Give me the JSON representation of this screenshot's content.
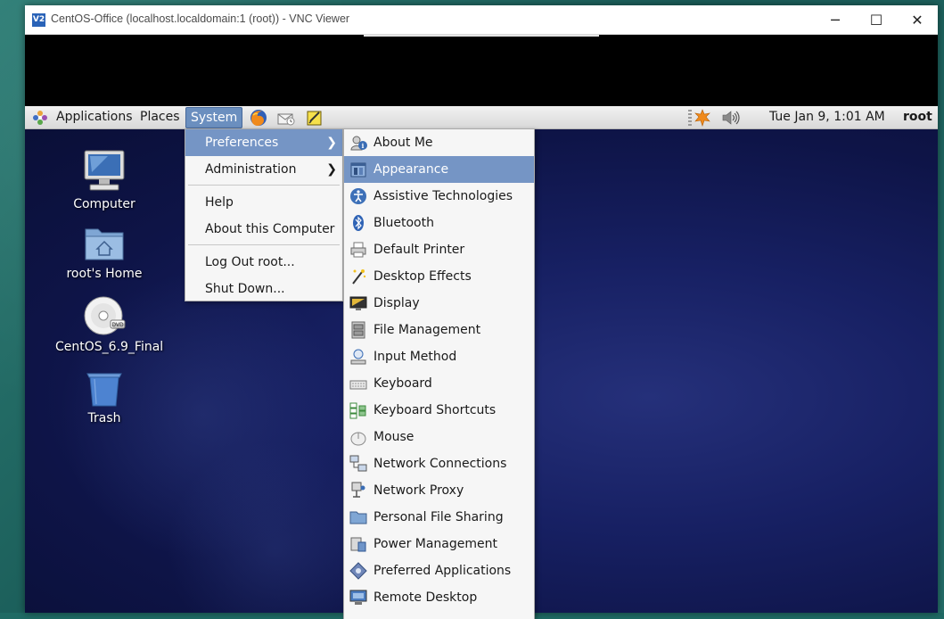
{
  "window": {
    "title": "CentOS-Office (localhost.localdomain:1 (root)) - VNC Viewer",
    "icon_text": "V2",
    "controls": {
      "minimize": "─",
      "maximize": "☐",
      "close": "✕"
    }
  },
  "panel": {
    "applications": "Applications",
    "places": "Places",
    "system": "System",
    "launchers": [
      "firefox-icon",
      "mail-icon",
      "notes-icon"
    ],
    "clock": "Tue Jan  9,  1:01 AM",
    "user": "root"
  },
  "desktop": {
    "icons": [
      {
        "label": "Computer",
        "icon": "computer-icon"
      },
      {
        "label": "root's Home",
        "icon": "home-folder-icon"
      },
      {
        "label": "CentOS_6.9_Final",
        "icon": "dvd-icon"
      },
      {
        "label": "Trash",
        "icon": "trash-icon"
      }
    ]
  },
  "system_menu": {
    "items": [
      {
        "label": "Preferences",
        "submenu": true,
        "highlighted": true
      },
      {
        "label": "Administration",
        "submenu": true
      },
      {
        "label": "Help"
      },
      {
        "label": "About this Computer"
      },
      {
        "label": "Log Out root..."
      },
      {
        "label": "Shut Down..."
      }
    ]
  },
  "preferences_menu": {
    "items": [
      {
        "label": "About Me",
        "icon": "about-me-icon"
      },
      {
        "label": "Appearance",
        "icon": "appearance-icon",
        "highlighted": true
      },
      {
        "label": "Assistive Technologies",
        "icon": "accessibility-icon"
      },
      {
        "label": "Bluetooth",
        "icon": "bluetooth-icon"
      },
      {
        "label": "Default Printer",
        "icon": "printer-icon"
      },
      {
        "label": "Desktop Effects",
        "icon": "desktop-effects-icon"
      },
      {
        "label": "Display",
        "icon": "display-icon"
      },
      {
        "label": "File Management",
        "icon": "file-management-icon"
      },
      {
        "label": "Input Method",
        "icon": "input-method-icon"
      },
      {
        "label": "Keyboard",
        "icon": "keyboard-icon"
      },
      {
        "label": "Keyboard Shortcuts",
        "icon": "keyboard-shortcuts-icon"
      },
      {
        "label": "Mouse",
        "icon": "mouse-icon"
      },
      {
        "label": "Network Connections",
        "icon": "network-connections-icon"
      },
      {
        "label": "Network Proxy",
        "icon": "network-proxy-icon"
      },
      {
        "label": "Personal File Sharing",
        "icon": "file-sharing-icon"
      },
      {
        "label": "Power Management",
        "icon": "power-management-icon"
      },
      {
        "label": "Preferred Applications",
        "icon": "preferred-apps-icon"
      },
      {
        "label": "Remote Desktop",
        "icon": "remote-desktop-icon"
      }
    ]
  },
  "colors": {
    "highlight": "#7595c5",
    "panel": "#e4e4e4",
    "desktop": "#172063"
  }
}
